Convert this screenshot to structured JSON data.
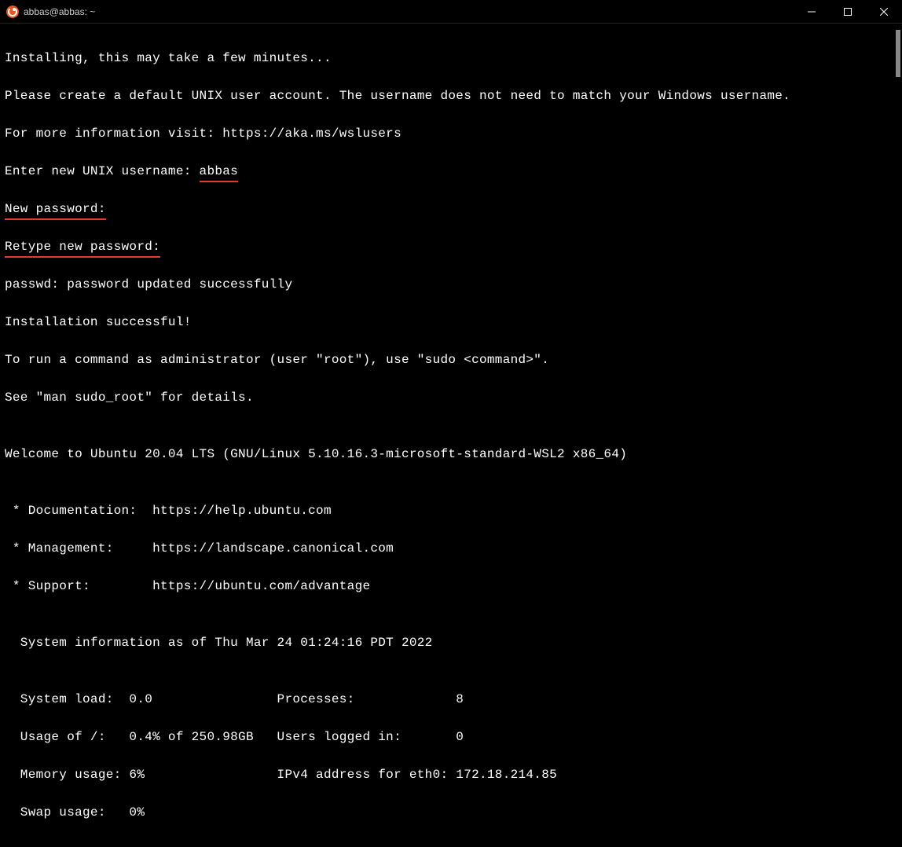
{
  "titlebar": {
    "title": "abbas@abbas: ~"
  },
  "terminal": {
    "lines": [
      "Installing, this may take a few minutes...",
      "Please create a default UNIX user account. The username does not need to match your Windows username.",
      "For more information visit: https://aka.ms/wslusers"
    ],
    "username_prompt": "Enter new UNIX username: ",
    "username_value": "abbas",
    "new_password_label": "New password:",
    "retype_password_label": "Retype new password:",
    "lines2": [
      "passwd: password updated successfully",
      "Installation successful!",
      "To run a command as administrator (user \"root\"), use \"sudo <command>\".",
      "See \"man sudo_root\" for details.",
      "",
      "Welcome to Ubuntu 20.04 LTS (GNU/Linux 5.10.16.3-microsoft-standard-WSL2 x86_64)",
      "",
      " * Documentation:  https://help.ubuntu.com",
      " * Management:     https://landscape.canonical.com",
      " * Support:        https://ubuntu.com/advantage",
      "",
      "  System information as of Thu Mar 24 01:24:16 PDT 2022",
      "",
      "  System load:  0.0                Processes:             8",
      "  Usage of /:   0.4% of 250.98GB   Users logged in:       0",
      "  Memory usage: 6%                 IPv4 address for eth0: 172.18.214.85",
      "  Swap usage:   0%"
    ]
  }
}
